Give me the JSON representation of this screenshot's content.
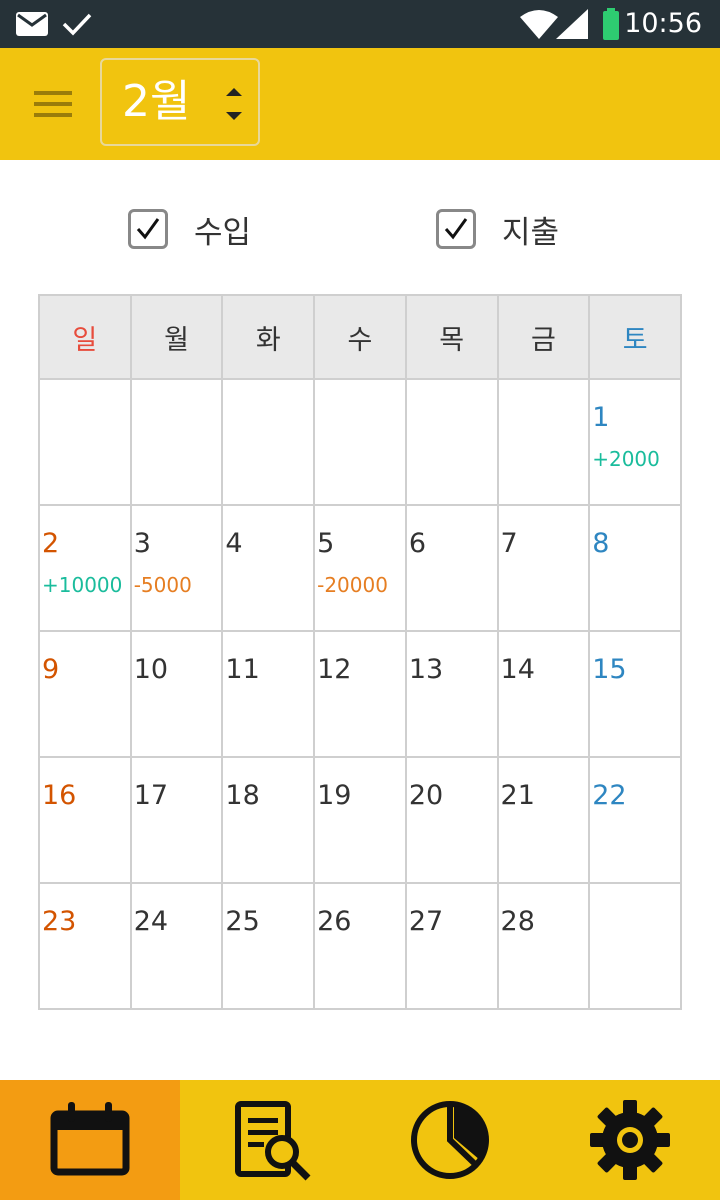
{
  "status_bar": {
    "time": "10:56",
    "icons": [
      "mail-icon",
      "check-icon",
      "wifi-icon",
      "signal-icon",
      "battery-icon"
    ]
  },
  "app_bar": {
    "month": "2월",
    "icons": [
      "menu-icon",
      "spinner-icon"
    ]
  },
  "filters": {
    "income_label": "수입",
    "expense_label": "지출",
    "income_checked": true,
    "expense_checked": true
  },
  "calendar": {
    "weekdays": [
      "일",
      "월",
      "화",
      "수",
      "목",
      "금",
      "토"
    ],
    "weeks": [
      [
        {
          "day": "",
          "amount": ""
        },
        {
          "day": "",
          "amount": ""
        },
        {
          "day": "",
          "amount": ""
        },
        {
          "day": "",
          "amount": ""
        },
        {
          "day": "",
          "amount": ""
        },
        {
          "day": "",
          "amount": ""
        },
        {
          "day": "1",
          "amount": "+2000"
        }
      ],
      [
        {
          "day": "2",
          "amount": "+10000"
        },
        {
          "day": "3",
          "amount": "-5000"
        },
        {
          "day": "4",
          "amount": ""
        },
        {
          "day": "5",
          "amount": "-20000"
        },
        {
          "day": "6",
          "amount": ""
        },
        {
          "day": "7",
          "amount": ""
        },
        {
          "day": "8",
          "amount": ""
        }
      ],
      [
        {
          "day": "9",
          "amount": ""
        },
        {
          "day": "10",
          "amount": ""
        },
        {
          "day": "11",
          "amount": ""
        },
        {
          "day": "12",
          "amount": ""
        },
        {
          "day": "13",
          "amount": ""
        },
        {
          "day": "14",
          "amount": ""
        },
        {
          "day": "15",
          "amount": ""
        }
      ],
      [
        {
          "day": "16",
          "amount": ""
        },
        {
          "day": "17",
          "amount": ""
        },
        {
          "day": "18",
          "amount": ""
        },
        {
          "day": "19",
          "amount": ""
        },
        {
          "day": "20",
          "amount": ""
        },
        {
          "day": "21",
          "amount": ""
        },
        {
          "day": "22",
          "amount": ""
        }
      ],
      [
        {
          "day": "23",
          "amount": ""
        },
        {
          "day": "24",
          "amount": ""
        },
        {
          "day": "25",
          "amount": ""
        },
        {
          "day": "26",
          "amount": ""
        },
        {
          "day": "27",
          "amount": ""
        },
        {
          "day": "28",
          "amount": ""
        },
        {
          "day": "",
          "amount": ""
        }
      ]
    ]
  },
  "bottom_nav": {
    "items": [
      {
        "icon": "calendar-icon",
        "active": true
      },
      {
        "icon": "report-search-icon",
        "active": false
      },
      {
        "icon": "pie-chart-icon",
        "active": false
      },
      {
        "icon": "settings-gear-icon",
        "active": false
      }
    ]
  },
  "colors": {
    "app_bar": "#F1C40F",
    "nav_active": "#F39C12",
    "status_bar": "#263238",
    "income": "#1ABC9C",
    "expense": "#E67E22",
    "sunday": "#D35400",
    "saturday": "#2E86C1"
  }
}
